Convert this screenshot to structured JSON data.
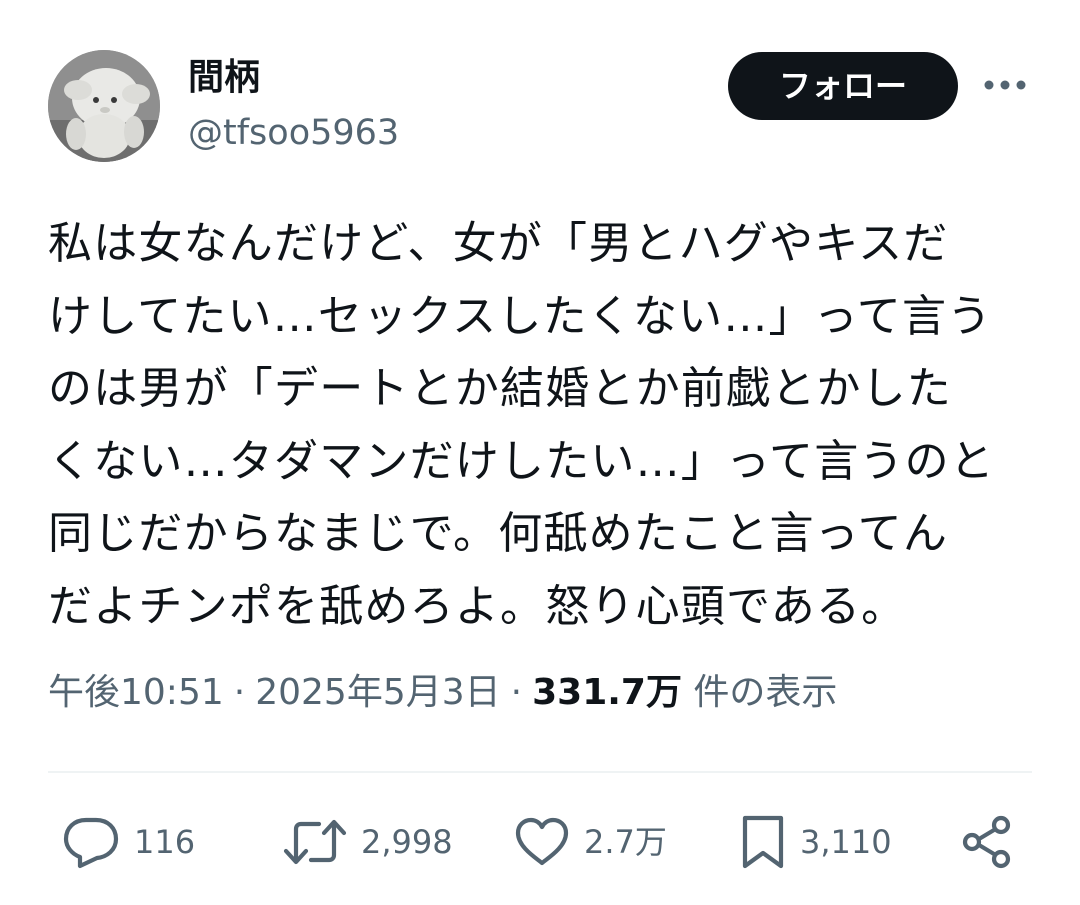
{
  "author": {
    "display_name": "間柄",
    "handle": "@tfsoo5963",
    "avatar_icon": "plush-toy-avatar"
  },
  "header": {
    "follow_label": "フォロー",
    "more_icon": "more-dots-icon"
  },
  "tweet": {
    "lines": [
      "私は女なんだけど、女が「男とハグやキスだ",
      "けしてたい…セックスしたくない…」って言う",
      "のは男が「デートとか結婚とか前戯とかした",
      "くない…タダマンだけしたい…」って言うのと",
      "同じだからなまじで。何舐めたこと言ってん",
      "だよチンポを舐めろよ。怒り心頭である。"
    ]
  },
  "meta": {
    "time": "午後10:51",
    "separator": "·",
    "date": "2025年5月3日",
    "views_count": "331.7万",
    "views_label": "件の表示"
  },
  "actions": {
    "reply": {
      "icon": "reply-icon",
      "count": "116"
    },
    "retweet": {
      "icon": "retweet-icon",
      "count": "2,998"
    },
    "like": {
      "icon": "heart-icon",
      "count": "2.7万"
    },
    "bookmark": {
      "icon": "bookmark-icon",
      "count": "3,110"
    },
    "share": {
      "icon": "share-icon"
    }
  },
  "colors": {
    "text_primary": "#0f1419",
    "text_secondary": "#536471",
    "follow_bg": "#0f1419",
    "divider": "#eff3f4"
  }
}
